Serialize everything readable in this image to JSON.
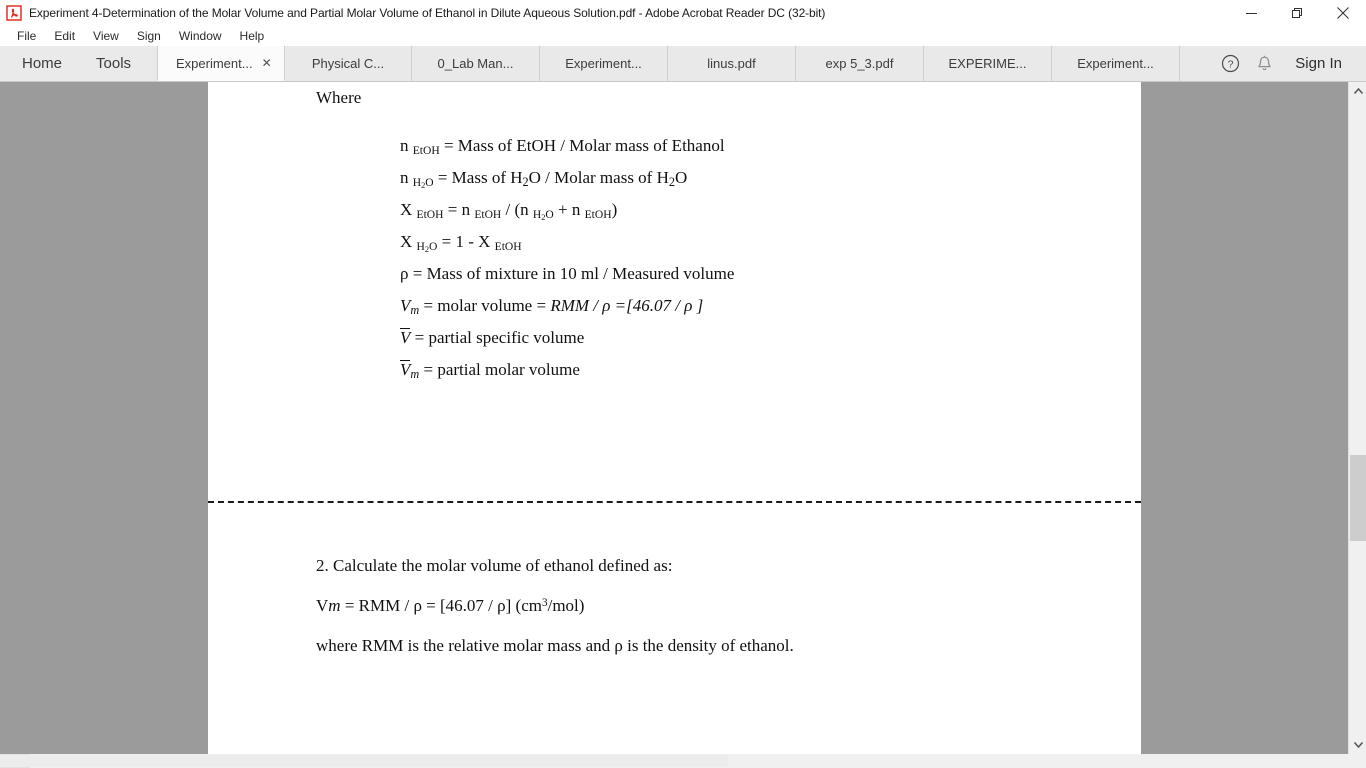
{
  "window": {
    "title": "Experiment 4-Determination of the Molar Volume and Partial Molar Volume of Ethanol in Dilute Aqueous Solution.pdf - Adobe Acrobat Reader DC (32-bit)",
    "app_icon": "acrobat-icon",
    "controls": {
      "minimize": "—",
      "maximize": "❐",
      "close": "✕"
    }
  },
  "menubar": {
    "items": [
      {
        "label": "File"
      },
      {
        "label": "Edit"
      },
      {
        "label": "View"
      },
      {
        "label": "Sign"
      },
      {
        "label": "Window"
      },
      {
        "label": "Help"
      }
    ]
  },
  "toolbar": {
    "home_label": "Home",
    "tools_label": "Tools",
    "help_icon": "question-circle-icon",
    "notification_icon": "bell-icon",
    "signin_label": "Sign In"
  },
  "tabs": [
    {
      "label": "Experiment...",
      "active": true,
      "close": "✕"
    },
    {
      "label": "Physical C...",
      "active": false
    },
    {
      "label": "0_Lab Man...",
      "active": false
    },
    {
      "label": "Experiment...",
      "active": false
    },
    {
      "label": "linus.pdf",
      "active": false
    },
    {
      "label": "exp 5_3.pdf",
      "active": false
    },
    {
      "label": "EXPERIME...",
      "active": false
    },
    {
      "label": "Experiment...",
      "active": false
    }
  ],
  "document": {
    "where_label": "Where",
    "formulas": [
      {
        "id": "n-etoh",
        "text": "n EtOH = Mass of EtOH / Molar mass of Ethanol"
      },
      {
        "id": "n-h2o",
        "text": "n H2O = Mass of H2O / Molar mass of H2O"
      },
      {
        "id": "x-etoh",
        "text": "X EtOH = n EtOH / (n H2O + n EtOH)"
      },
      {
        "id": "x-h2o",
        "text": "X H2O = 1 - X EtOH"
      },
      {
        "id": "rho",
        "text": "ρ = Mass of mixture in 10 ml / Measured volume"
      },
      {
        "id": "vm",
        "text": "Vm = molar volume = RMM / ρ =[46.07 / ρ ]"
      },
      {
        "id": "vbar",
        "text": "V̄ = partial specific volume"
      },
      {
        "id": "vbar-m",
        "text": "V̄m = partial molar volume"
      }
    ],
    "formula_parts": {
      "n": "n",
      "X": "X",
      "etoh_sub": "EtOH",
      "h2o_sub": "H",
      "h2o_sub_num": "2",
      "h2o_sub_o": "O",
      "eq": "=",
      "mass_of_etoh": "Mass of EtOH / Molar mass of Ethanol",
      "mass_of": "Mass of H",
      "molar_mass_of": "O / Molar mass of H",
      "slash": "/",
      "plus": "+",
      "one_minus": "1 - ",
      "rho_sym": "ρ",
      "rho_line": "= Mass of mixture in 10 ml / Measured volume",
      "v_sym": "V",
      "m_sub": "m",
      "vm_line": "= molar volume =",
      "rmm": "RMM",
      "vm_tail": "=[46.07 /",
      "bracket_close": "]",
      "partial_specific": "= partial specific volume",
      "partial_molar": "= partial molar volume"
    },
    "question": {
      "number_line": "2. Calculate the molar volume of ethanol defined as:",
      "equation_prefix": "V",
      "equation_italic_m": "m",
      "equation_body": " = RMM / ρ = [46.07 / ρ] (cm",
      "equation_sup": "3",
      "equation_tail": "/mol)",
      "note_line": "where RMM is the relative molar mass and ρ is the density of ethanol."
    }
  },
  "scrollbars": {
    "vertical": {
      "up_arrow": "▲",
      "down_arrow": "▼"
    },
    "horizontal": {
      "present": true
    }
  },
  "colors": {
    "accent_red": "#e2231a",
    "viewport_gray": "#9b9b9b",
    "tabbar_gray": "#e9e9e9",
    "page_white": "#ffffff"
  }
}
